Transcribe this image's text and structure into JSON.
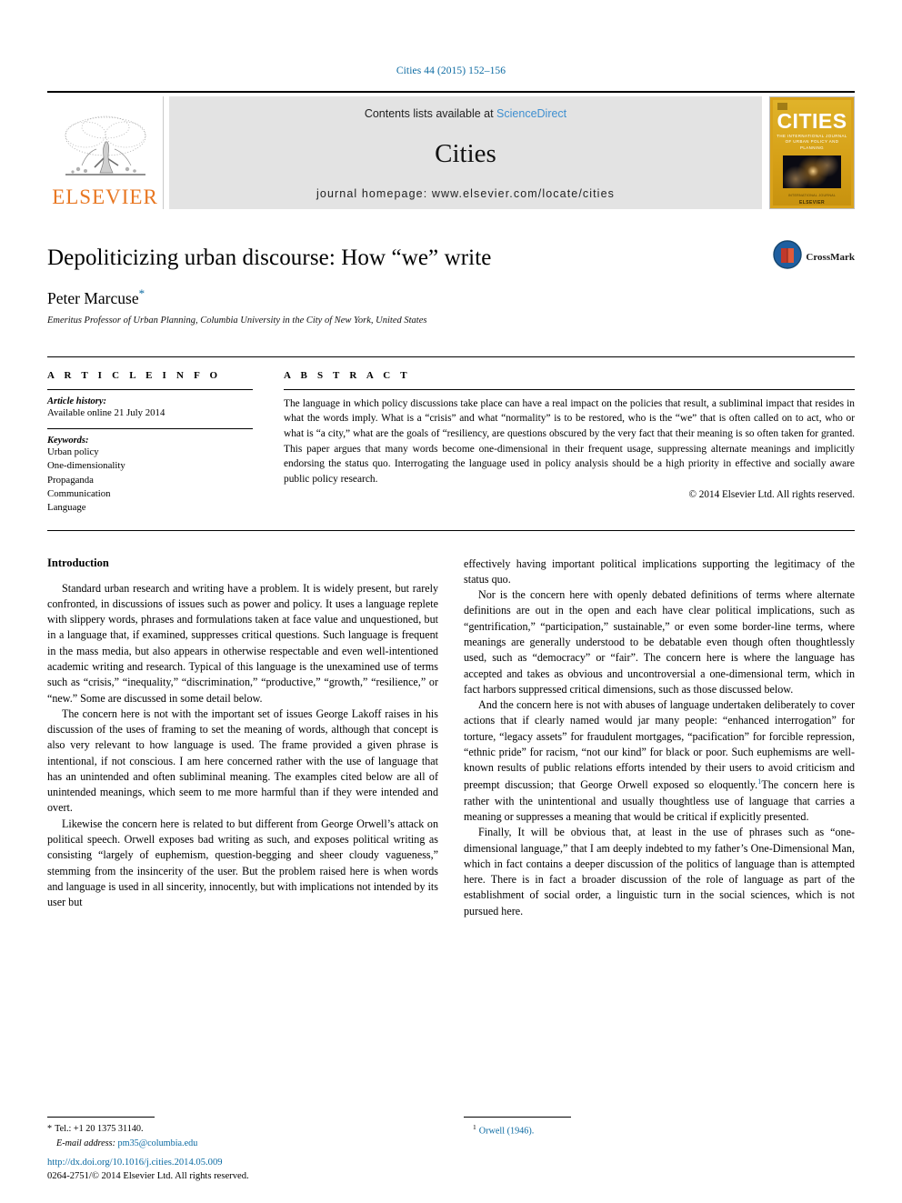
{
  "running_head": "Cities 44 (2015) 152–156",
  "masthead": {
    "publisher_name": "ELSEVIER",
    "contents_line_prefix": "Contents lists available at ",
    "sciencedirect_label": "ScienceDirect",
    "journal_name": "Cities",
    "homepage_line": "journal homepage: www.elsevier.com/locate/cities",
    "cover": {
      "title": "CITIES",
      "subtitle": "THE INTERNATIONAL JOURNAL OF URBAN POLICY AND PLANNING",
      "footer_small": "INTERNATIONAL JOURNAL",
      "footer_brand": "ELSEVIER"
    }
  },
  "article": {
    "title": "Depoliticizing urban discourse: How “we” write",
    "author": "Peter Marcuse",
    "author_marker": "*",
    "affiliation": "Emeritus Professor of Urban Planning, Columbia University in the City of New York, United States",
    "crossmark_label": "CrossMark"
  },
  "info": {
    "heading": "A R T I C L E   I N F O",
    "history_label": "Article history:",
    "history_value": "Available online 21 July 2014",
    "keywords_label": "Keywords:",
    "keywords": [
      "Urban policy",
      "One-dimensionality",
      "Propaganda",
      "Communication",
      "Language"
    ]
  },
  "abstract": {
    "heading": "A B S T R A C T",
    "text": "The language in which policy discussions take place can have a real impact on the policies that result, a subliminal impact that resides in what the words imply. What is a “crisis” and what “normality” is to be restored, who is the “we” that is often called on to act, who or what is “a city,” what are the goals of “resiliency, are questions obscured by the very fact that their meaning is so often taken for granted. This paper argues that many words become one-dimensional in their frequent usage, suppressing alternate meanings and implicitly endorsing the status quo. Interrogating the language used in policy analysis should be a high priority in effective and socially aware public policy research.",
    "copyright": "© 2014 Elsevier Ltd. All rights reserved."
  },
  "body": {
    "section_title": "Introduction",
    "left_paragraphs": [
      "Standard urban research and writing have a problem. It is widely present, but rarely confronted, in discussions of issues such as power and policy. It uses a language replete with slippery words, phrases and formulations taken at face value and unquestioned, but in a language that, if examined, suppresses critical questions. Such language is frequent in the mass media, but also appears in otherwise respectable and even well-intentioned academic writing and research. Typical of this language is the unexamined use of terms such as “crisis,” “inequality,” “discrimination,” “productive,” “growth,” “resilience,” or “new.” Some are discussed in some detail below.",
      "The concern here is not with the important set of issues George Lakoff raises in his discussion of the uses of framing to set the meaning of words, although that concept is also very relevant to how language is used. The frame provided a given phrase is intentional, if not conscious. I am here concerned rather with the use of language that has an unintended and often subliminal meaning. The examples cited below are all of unintended meanings, which seem to me more harmful than if they were intended and overt.",
      "Likewise the concern here is related to but different from George Orwell’s attack on political speech. Orwell exposes bad writing as such, and exposes political writing as consisting “largely of euphemism, question-begging and sheer cloudy vagueness,” stemming from the insincerity of the user. But the problem raised here is when words and language is used in all sincerity, innocently, but with implications not intended by its user but"
    ],
    "right_paragraphs": [
      "effectively having important political implications supporting the legitimacy of the status quo.",
      "Nor is the concern here with openly debated definitions of terms where alternate definitions are out in the open and each have clear political implications, such as “gentrification,” “participation,” sustainable,” or even some border-line terms, where meanings are generally understood to be debatable even though often thoughtlessly used, such as “democracy” or “fair”. The concern here is where the language has accepted and takes as obvious and uncontroversial a one-dimensional term, which in fact harbors suppressed critical dimensions, such as those discussed below.",
      "And the concern here is not with abuses of language undertaken deliberately to cover actions that if clearly named would jar many people: “enhanced interrogation” for torture, “legacy assets” for fraudulent mortgages, “pacification” for forcible repression, “ethnic pride” for racism, “not our kind” for black or poor. Such euphemisms are well-known results of public relations efforts intended by their users to avoid criticism and preempt discussion; that George Orwell exposed so eloquently.",
      "The concern here is rather with the unintentional and usually thoughtless use of language that carries a meaning or suppresses a meaning that would be critical if explicitly presented.",
      "Finally, It will be obvious that, at least in the use of phrases such as “one-dimensional language,” that I am deeply indebted to my father’s One-Dimensional Man, which in fact contains a deeper discussion of the politics of language than is attempted here. There is in fact a broader discussion of the role of language as part of the establishment of social order, a linguistic turn in the social sciences, which is not pursued here."
    ],
    "footnote_marker": "1"
  },
  "footnotes": {
    "star_marker": "*",
    "tel": "Tel.: +1 20 1375 31140.",
    "email_label": "E-mail address:",
    "email": "pm35@columbia.edu",
    "note_number": "1",
    "note_text": "Orwell (1946)."
  },
  "doi": {
    "url": "http://dx.doi.org/10.1016/j.cities.2014.05.009",
    "issn_line": "0264-2751/© 2014 Elsevier Ltd. All rights reserved."
  },
  "colors": {
    "link": "#0b6aa2",
    "sciencedirect": "#3e8fd0",
    "elsevier_orange": "#e87722",
    "banner_gray": "#e3e3e3",
    "cover_gold": "#d9a21b"
  }
}
